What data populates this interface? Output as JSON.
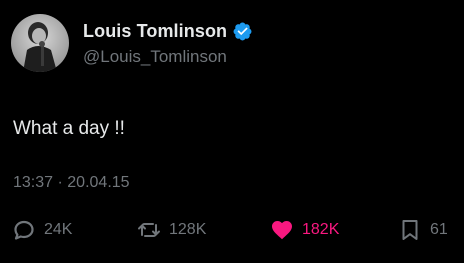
{
  "user": {
    "display_name": "Louis Tomlinson",
    "handle": "@Louis_Tomlinson",
    "verified": true
  },
  "tweet": {
    "text": "What a day !!",
    "time": "13:37",
    "separator": "·",
    "date": "20.04.15"
  },
  "actions": {
    "replies": "24K",
    "retweets": "128K",
    "likes": "182K",
    "bookmarks": "61"
  },
  "colors": {
    "background": "#000000",
    "text": "#e7e9ea",
    "muted": "#71767b",
    "verified": "#1d9bf0",
    "like": "#f91880"
  },
  "icons": {
    "reply": "reply-bubble-icon",
    "retweet": "retweet-icon",
    "like": "heart-icon",
    "bookmark": "bookmark-icon",
    "verified": "verified-badge-icon"
  }
}
